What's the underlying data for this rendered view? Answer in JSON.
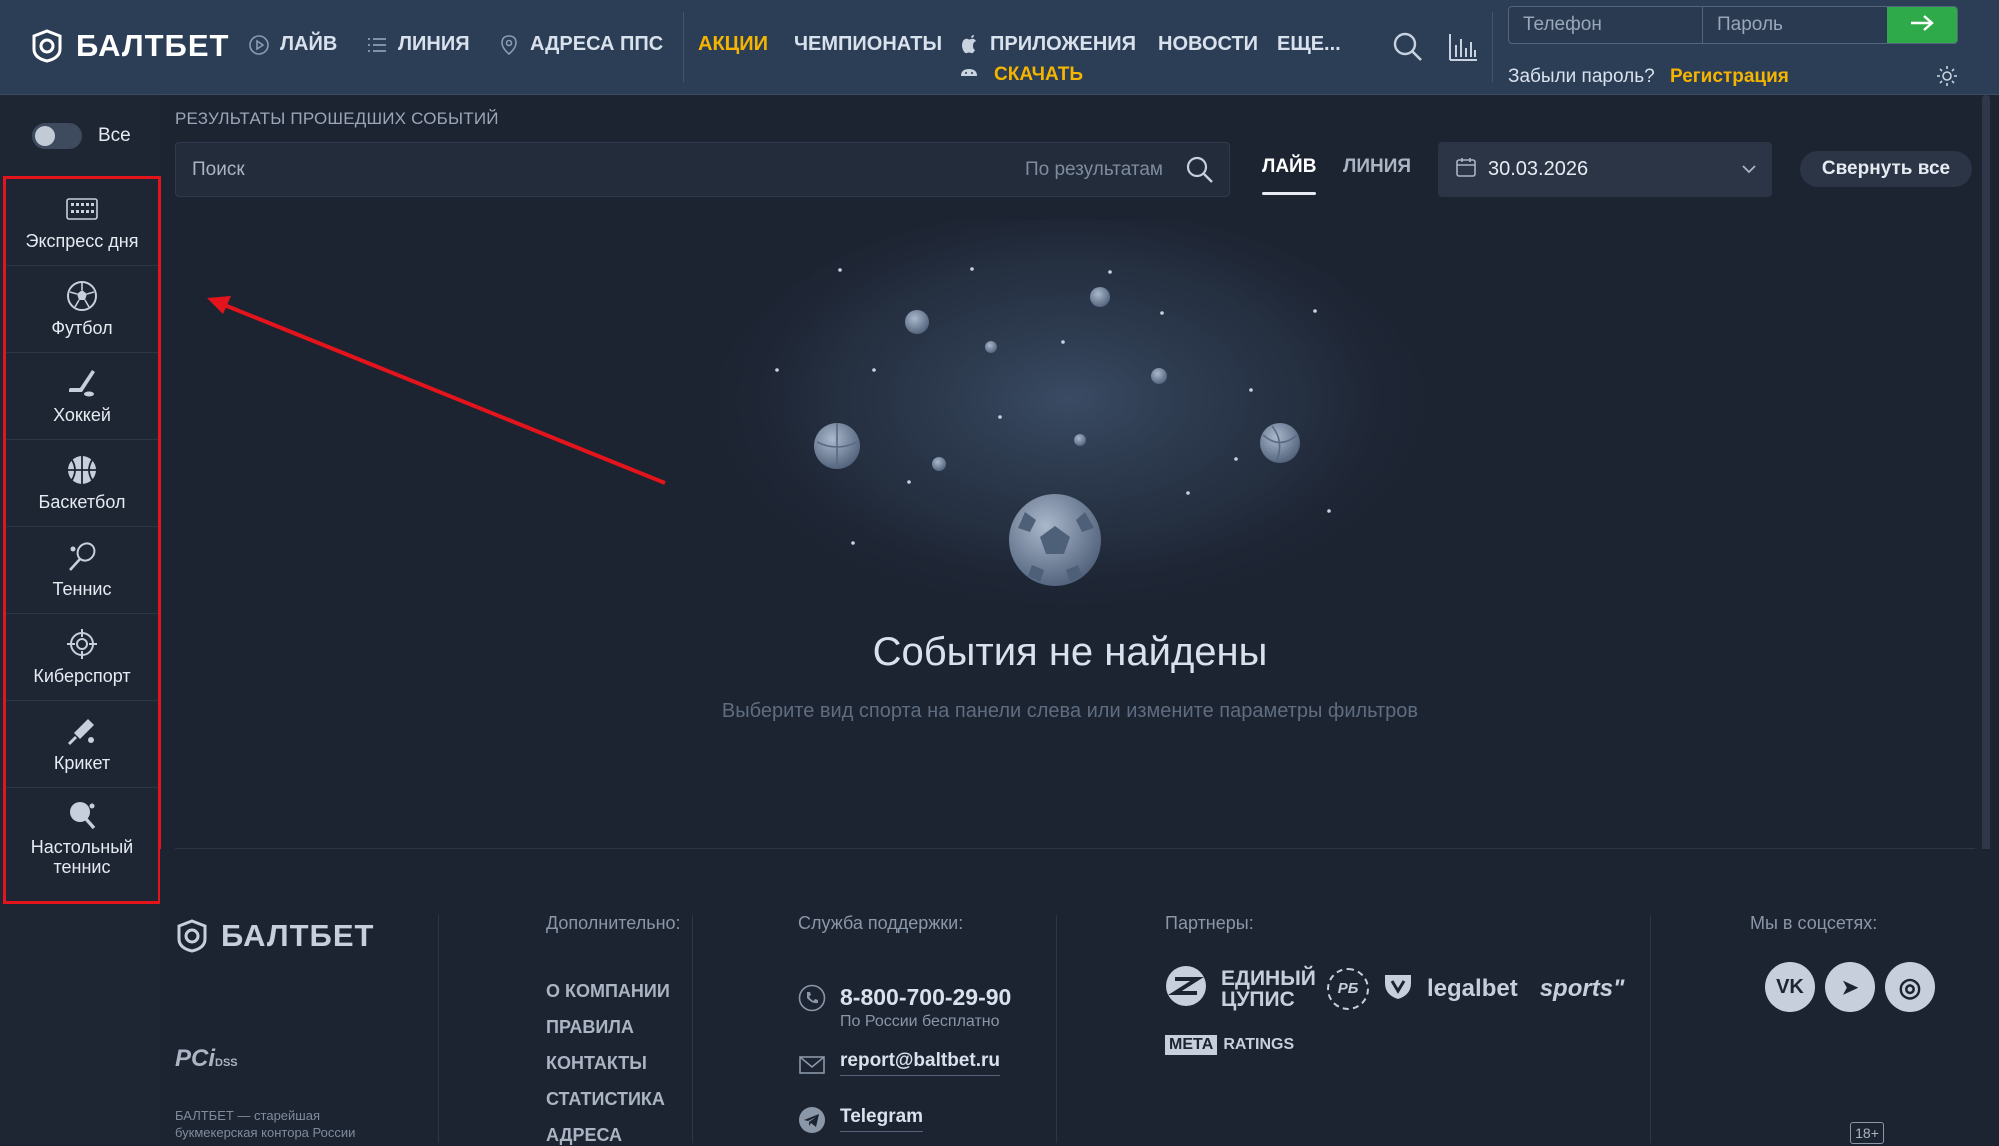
{
  "header": {
    "logo": "БАЛТБЕТ",
    "nav": {
      "live": "ЛАЙВ",
      "line": "ЛИНИЯ",
      "addresses": "АДРЕСА ППС",
      "promo": "АКЦИИ",
      "championships": "ЧЕМПИОНАТЫ",
      "apps": "ПРИЛОЖЕНИЯ",
      "download": "СКАЧАТЬ",
      "news": "НОВОСТИ",
      "more": "ЕЩЕ..."
    },
    "login": {
      "phone_placeholder": "Телефон",
      "password_placeholder": "Пароль",
      "forgot": "Забыли пароль?",
      "register": "Регистрация"
    }
  },
  "sidebar": {
    "toggle_label": "Все",
    "items": [
      {
        "label": "Экспресс дня",
        "icon": "calendar-grid-icon"
      },
      {
        "label": "Футбол",
        "icon": "soccer-ball-icon"
      },
      {
        "label": "Хоккей",
        "icon": "hockey-stick-icon"
      },
      {
        "label": "Баскетбол",
        "icon": "basketball-icon"
      },
      {
        "label": "Теннис",
        "icon": "tennis-racket-icon"
      },
      {
        "label": "Киберспорт",
        "icon": "crosshair-icon"
      },
      {
        "label": "Крикет",
        "icon": "cricket-bat-icon"
      },
      {
        "label": "Настольный теннис",
        "icon": "ping-pong-icon"
      }
    ]
  },
  "main": {
    "section_title": "РЕЗУЛЬТАТЫ ПРОШЕДШИХ СОБЫТИЙ",
    "search_placeholder": "Поиск",
    "search_scope": "По результатам",
    "tabs": {
      "live": "ЛАЙВ",
      "line": "ЛИНИЯ"
    },
    "date": "30.03.2026",
    "collapse_all": "Свернуть все",
    "empty_title": "События не найдены",
    "empty_subtitle": "Выберите вид спорта на панели слева или измените параметры фильтров"
  },
  "footer": {
    "logo": "БАЛТБЕТ",
    "pci": "PCi",
    "pci_dss": "DSS",
    "about": "БАЛТБЕТ — старейшая букмекерская контора России",
    "more_heading": "Дополнительно:",
    "links": [
      "О КОМПАНИИ",
      "ПРАВИЛА",
      "КОНТАКТЫ",
      "СТАТИСТИКА",
      "АДРЕСА"
    ],
    "support_heading": "Служба поддержки:",
    "phone": "8-800-700-29-90",
    "phone_note": "По России бесплатно",
    "email": "report@baltbet.ru",
    "telegram": "Telegram",
    "partners_heading": "Партнеры:",
    "partner_cupis": "ЕДИНЫЙ ЦУПИС",
    "partner_rb": "РБ",
    "partner_legalbet": "legalbet",
    "partner_sports": "sports\"",
    "partner_meta_box": "МЕТА",
    "partner_meta_text": "RATINGS",
    "social_heading": "Мы в соцсетях:",
    "social": {
      "vk": "VK",
      "telegram": "➤",
      "max": "◎"
    },
    "age": "18+"
  },
  "colors": {
    "accent": "#f5b400",
    "green": "#2faa4a",
    "highlight": "#e3141b",
    "background": "#1c2331",
    "header": "#2c3e56"
  }
}
